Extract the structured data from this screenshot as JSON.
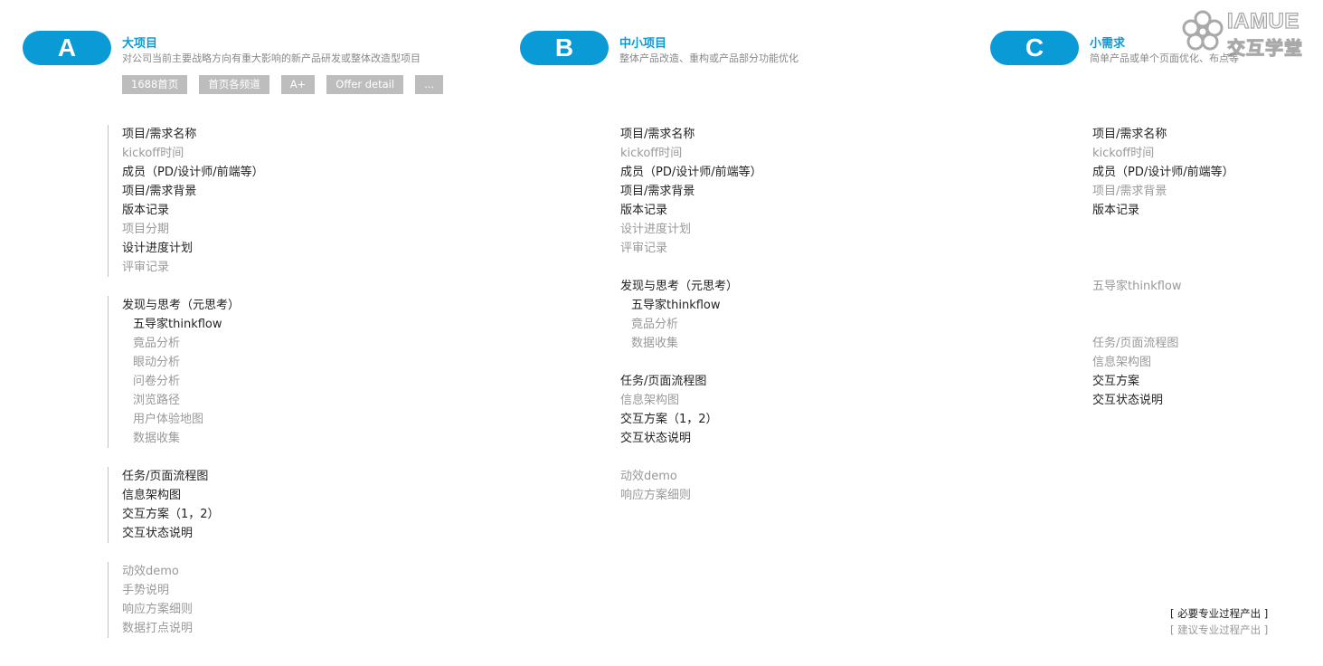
{
  "logo": {
    "text_en": "IAMUE",
    "text_cn": "交互学堂"
  },
  "categories": [
    {
      "letter": "A",
      "title": "大项目",
      "desc": "对公司当前主要战略方向有重大影响的新产品研发或整体改造型项目",
      "tags": [
        "1688首页",
        "首页各频道",
        "A+",
        "Offer detail",
        "..."
      ],
      "groups": [
        {
          "items": [
            {
              "text": "项目/需求名称",
              "required": true
            },
            {
              "text": "kickoff时间",
              "required": false
            },
            {
              "text": "成员（PD/设计师/前端等）",
              "required": true
            },
            {
              "text": "项目/需求背景",
              "required": true
            },
            {
              "text": "版本记录",
              "required": true
            },
            {
              "text": "项目分期",
              "required": false
            },
            {
              "text": "设计进度计划",
              "required": true
            },
            {
              "text": "评审记录",
              "required": false
            }
          ]
        },
        {
          "items": [
            {
              "text": "发现与思考（元思考）",
              "required": true
            },
            {
              "text": "五导家thinkflow",
              "required": true
            },
            {
              "text": "竟品分析",
              "required": false
            },
            {
              "text": "眼动分析",
              "required": false
            },
            {
              "text": "问卷分析",
              "required": false
            },
            {
              "text": "浏览路径",
              "required": false
            },
            {
              "text": "用户体验地图",
              "required": false
            },
            {
              "text": "数据收集",
              "required": false
            }
          ]
        },
        {
          "items": [
            {
              "text": "任务/页面流程图",
              "required": true
            },
            {
              "text": "信息架构图",
              "required": true
            },
            {
              "text": "交互方案（1，2）",
              "required": true
            },
            {
              "text": "交互状态说明",
              "required": true
            }
          ]
        },
        {
          "items": [
            {
              "text": "动效demo",
              "required": false
            },
            {
              "text": "手势说明",
              "required": false
            },
            {
              "text": "响应方案细则",
              "required": false
            },
            {
              "text": "数据打点说明",
              "required": false
            }
          ]
        }
      ]
    },
    {
      "letter": "B",
      "title": "中小项目",
      "desc": "整体产品改造、重构或产品部分功能优化",
      "groups": [
        {
          "items": [
            {
              "text": "项目/需求名称",
              "required": true
            },
            {
              "text": "kickoff时间",
              "required": false
            },
            {
              "text": "成员（PD/设计师/前端等）",
              "required": true
            },
            {
              "text": "项目/需求背景",
              "required": true
            },
            {
              "text": "版本记录",
              "required": true
            },
            {
              "text": "设计进度计划",
              "required": false
            },
            {
              "text": "评审记录",
              "required": false
            }
          ]
        },
        {
          "items": [
            {
              "text": "发现与思考（元思考）",
              "required": true
            },
            {
              "text": "五导家thinkflow",
              "required": true
            },
            {
              "text": "竟品分析",
              "required": false
            },
            {
              "text": "数据收集",
              "required": false
            }
          ]
        },
        {
          "items": [
            {
              "text": "任务/页面流程图",
              "required": true
            },
            {
              "text": "信息架构图",
              "required": false
            },
            {
              "text": "交互方案（1，2）",
              "required": true
            },
            {
              "text": "交互状态说明",
              "required": true
            }
          ]
        },
        {
          "items": [
            {
              "text": "动效demo",
              "required": false
            },
            {
              "text": "响应方案细则",
              "required": false
            }
          ]
        }
      ]
    },
    {
      "letter": "C",
      "title": "小需求",
      "desc": "简单产品或单个页面优化、布点等",
      "groups": [
        {
          "items": [
            {
              "text": "项目/需求名称",
              "required": true
            },
            {
              "text": "kickoff时间",
              "required": false
            },
            {
              "text": "成员（PD/设计师/前端等）",
              "required": true
            },
            {
              "text": "项目/需求背景",
              "required": false
            },
            {
              "text": "版本记录",
              "required": true
            }
          ]
        },
        {
          "items": [
            {
              "text": "五导家thinkflow",
              "required": false
            }
          ]
        },
        {
          "items": [
            {
              "text": "任务/页面流程图",
              "required": false
            },
            {
              "text": "信息架构图",
              "required": false
            },
            {
              "text": "交互方案",
              "required": true
            },
            {
              "text": "交互状态说明",
              "required": true
            }
          ]
        }
      ]
    }
  ],
  "legend": {
    "required": "[ 必要专业过程产出 ]",
    "optional": "[ 建议专业过程产出 ]"
  },
  "colors": {
    "accent": "#0a9bd6",
    "tag": "#bdbdbd",
    "required_text": "#222222",
    "optional_text": "#999999"
  }
}
